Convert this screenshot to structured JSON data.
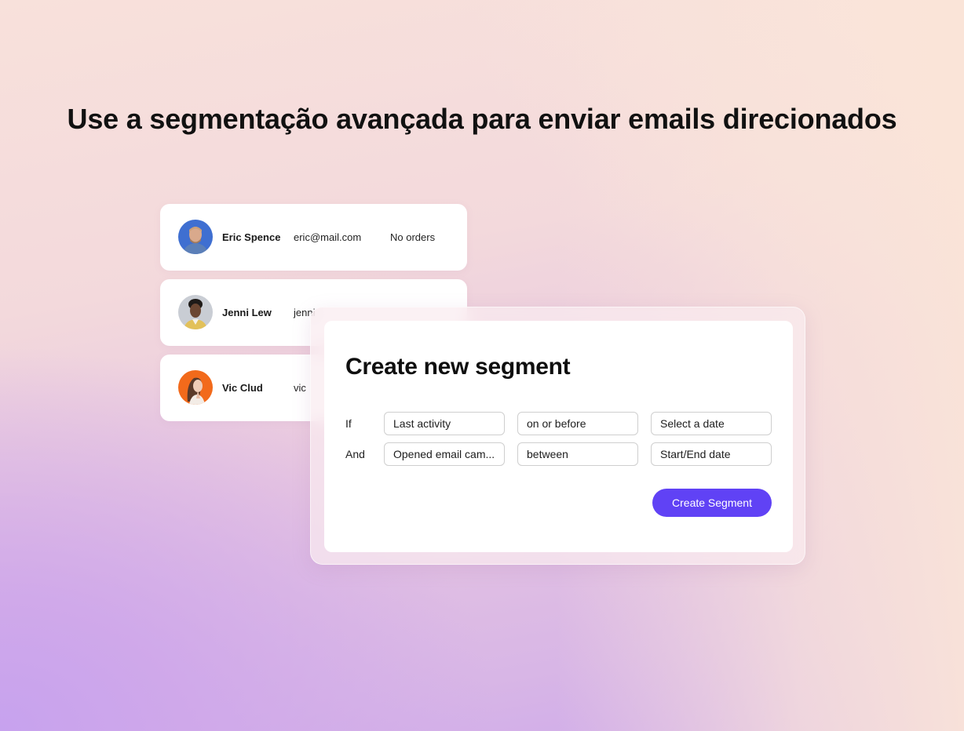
{
  "headline": "Use a segmentação avançada para enviar emails direcionados",
  "contacts": [
    {
      "name": "Eric Spence",
      "email": "eric@mail.com",
      "orders": "No orders",
      "avatar_bg": "#3f6fd1"
    },
    {
      "name": "Jenni Lew",
      "email": "jenni",
      "avatar_bg": "#c9cdd4"
    },
    {
      "name": "Vic Clud",
      "email": "vic",
      "avatar_bg": "#f26a1b"
    }
  ],
  "segment_modal": {
    "title": "Create new segment",
    "rows": [
      {
        "label": "If",
        "field": "Last activity",
        "operator": "on or before",
        "value": "Select a date"
      },
      {
        "label": "And",
        "field": "Opened email cam...",
        "operator": "between",
        "value": "Start/End date"
      }
    ],
    "submit_label": "Create Segment"
  },
  "colors": {
    "accent": "#6042f5",
    "text": "#111111",
    "field_border": "#cfcfcf"
  }
}
